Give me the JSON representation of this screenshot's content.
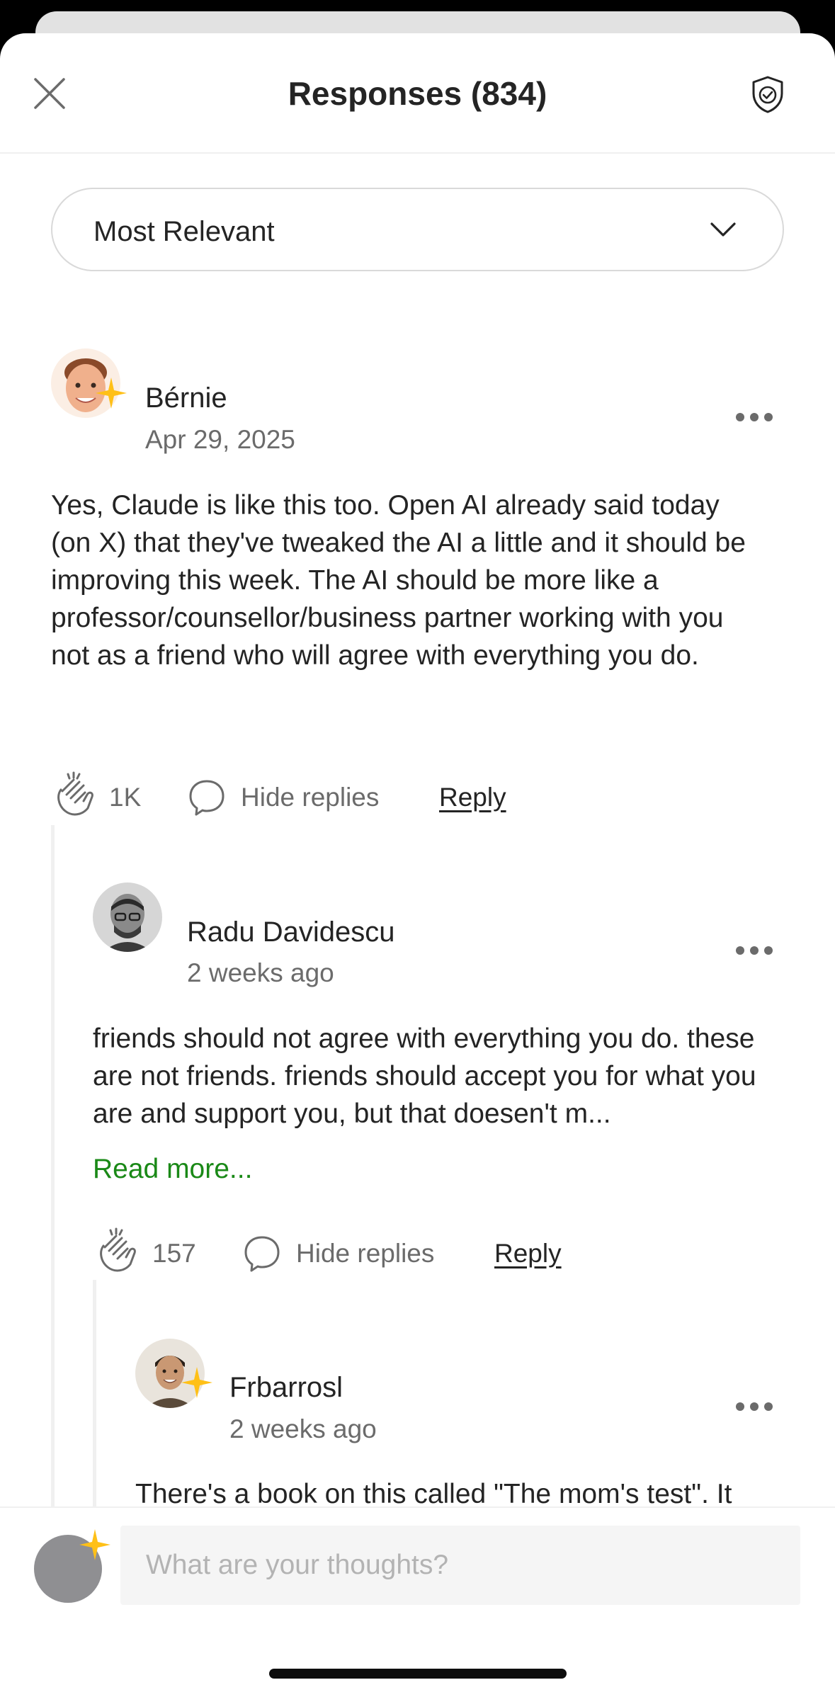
{
  "header": {
    "title": "Responses (834)"
  },
  "sort": {
    "label": "Most Relevant"
  },
  "comments": [
    {
      "name": "Bérnie",
      "date": "Apr 29, 2025",
      "text": "Yes, Claude is like this too. Open AI already said today (on X) that they've tweaked the AI a little and it should be improving this week. The AI should be more like a professor/counsellor/business partner working with you not as a friend who will agree with everything you do.",
      "claps": "1K",
      "hide_replies": "Hide replies",
      "reply": "Reply"
    },
    {
      "name": "Radu Davidescu",
      "date": "2 weeks ago",
      "text": "friends should not agree with everything you do. these are not friends. friends should accept you for what you are and support you, but that doesen't m...",
      "read_more": "Read more...",
      "claps": "157",
      "hide_replies": "Hide replies",
      "reply": "Reply"
    },
    {
      "name": "Frbarrosl",
      "date": "2 weeks ago",
      "text": "There's a book on this called \"The mom's test\". It describe how to ask for honest feedback in a way"
    }
  ],
  "composer": {
    "placeholder": "What are your thoughts?"
  },
  "icons": {
    "close": "close-icon",
    "shield": "shield-icon",
    "chevron": "chevron-down-icon",
    "more": "more-icon",
    "clap": "clap-icon",
    "bubble": "comment-bubble-icon",
    "star": "member-star-icon"
  },
  "colors": {
    "accent_green": "#1a8917",
    "star": "#ffc017",
    "text": "#242424",
    "muted": "#6b6b6b"
  }
}
